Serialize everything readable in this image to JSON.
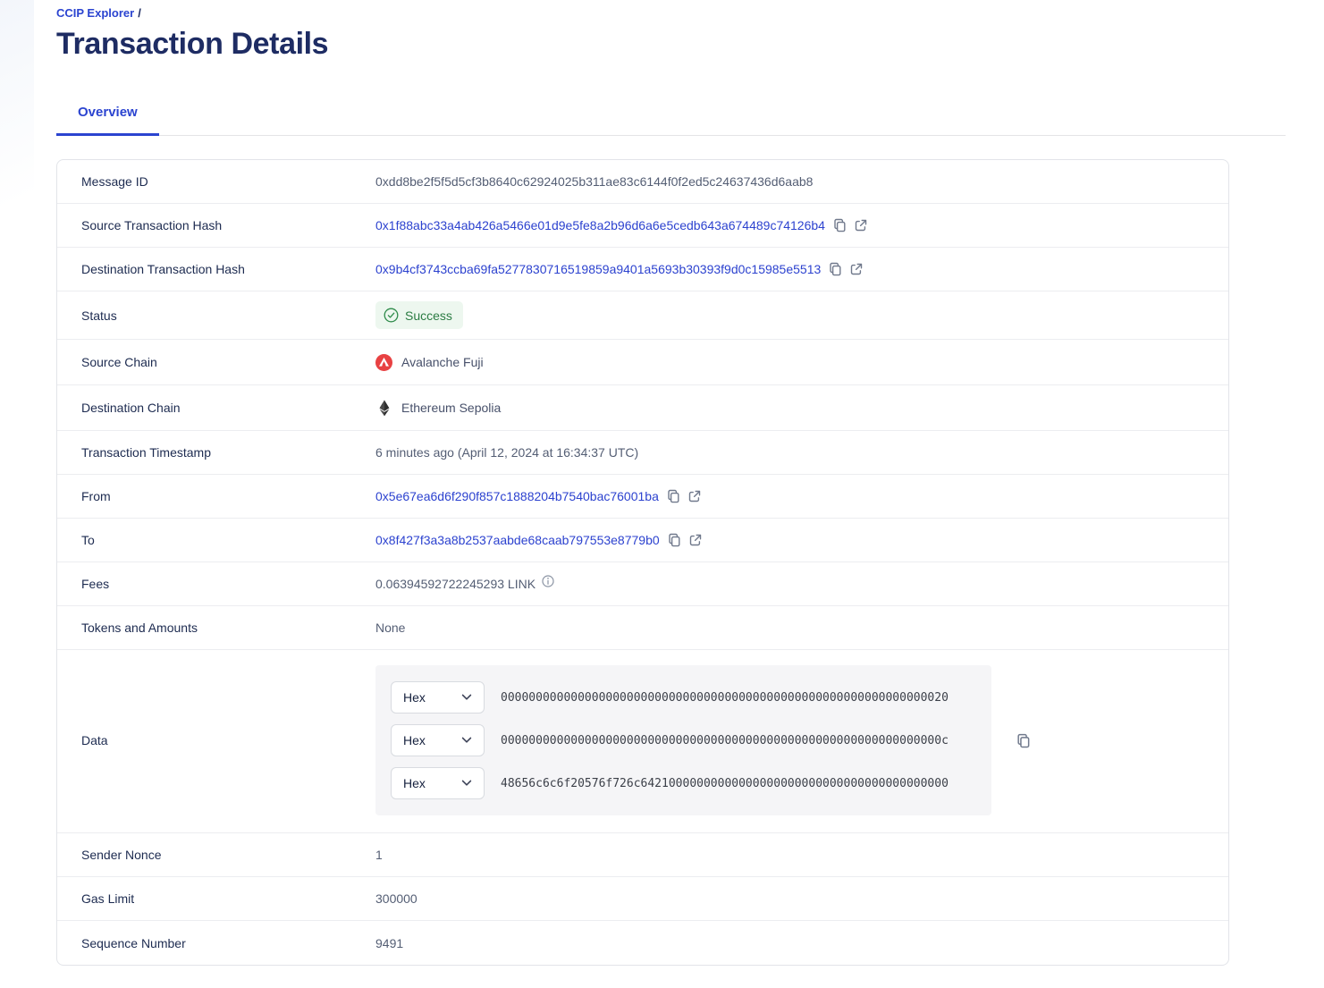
{
  "breadcrumb": {
    "label": "CCIP Explorer",
    "separator": "/"
  },
  "title": "Transaction Details",
  "tabs": {
    "overview": "Overview"
  },
  "rows": {
    "message_id": {
      "label": "Message ID",
      "value": "0xdd8be2f5f5d5cf3b8640c62924025b311ae83c6144f0f2ed5c24637436d6aab8"
    },
    "source_tx": {
      "label": "Source Transaction Hash",
      "value": "0x1f88abc33a4ab426a5466e01d9e5fe8a2b96d6a6e5cedb643a674489c74126b4"
    },
    "dest_tx": {
      "label": "Destination Transaction Hash",
      "value": "0x9b4cf3743ccba69fa5277830716519859a9401a5693b30393f9d0c15985e5513"
    },
    "status": {
      "label": "Status",
      "value": "Success"
    },
    "source_chain": {
      "label": "Source Chain",
      "value": "Avalanche Fuji"
    },
    "dest_chain": {
      "label": "Destination Chain",
      "value": "Ethereum Sepolia"
    },
    "timestamp": {
      "label": "Transaction Timestamp",
      "value": "6 minutes ago (April 12, 2024 at 16:34:37 UTC)"
    },
    "from": {
      "label": "From",
      "value": "0x5e67ea6d6f290f857c1888204b7540bac76001ba"
    },
    "to": {
      "label": "To",
      "value": "0x8f427f3a3a8b2537aabde68caab797553e8779b0"
    },
    "fees": {
      "label": "Fees",
      "value": "0.06394592722245293 LINK"
    },
    "tokens": {
      "label": "Tokens and Amounts",
      "value": "None"
    },
    "data": {
      "label": "Data",
      "selector": "Hex",
      "lines": [
        "0000000000000000000000000000000000000000000000000000000000000020",
        "000000000000000000000000000000000000000000000000000000000000000c",
        "48656c6c6f20576f726c64210000000000000000000000000000000000000000"
      ]
    },
    "sender_nonce": {
      "label": "Sender Nonce",
      "value": "1"
    },
    "gas_limit": {
      "label": "Gas Limit",
      "value": "300000"
    },
    "sequence_number": {
      "label": "Sequence Number",
      "value": "9491"
    }
  },
  "icons": {
    "copy": "copy-icon",
    "external_link": "external-link-icon",
    "status": "check-circle-icon",
    "source_chain": "avalanche-logo-icon",
    "dest_chain": "ethereum-logo-icon",
    "fees_info": "info-icon",
    "hex_dropdown": "chevron-down-icon"
  },
  "colors": {
    "link_blue": "#2c42cf",
    "title_navy": "#1e2c63",
    "label_navy": "#1d2b50",
    "value_slate": "#545e74",
    "success_text": "#2b7c43",
    "success_bg": "#edf7ef",
    "avalanche_red": "#e84142",
    "panel_gray": "#f5f5f7"
  }
}
